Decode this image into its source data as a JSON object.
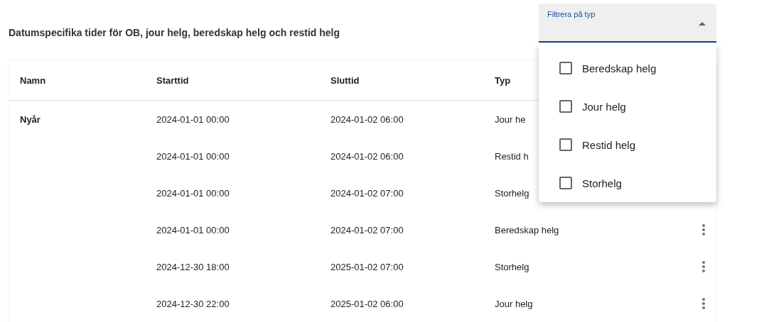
{
  "title": "Datumspecifika tider för OB, jour helg, beredskap helg och restid helg",
  "filter": {
    "label": "Filtrera på typ",
    "expanded": true,
    "options": [
      {
        "label": "Beredskap helg",
        "checked": false
      },
      {
        "label": "Jour helg",
        "checked": false
      },
      {
        "label": "Restid helg",
        "checked": false
      },
      {
        "label": "Storhelg",
        "checked": false
      }
    ]
  },
  "table": {
    "columns": [
      "Namn",
      "Starttid",
      "Sluttid",
      "Typ"
    ],
    "rows": [
      {
        "name": "Nyår",
        "start": "2024-01-01 00:00",
        "end": "2024-01-02 06:00",
        "type": "Jour he"
      },
      {
        "name": "",
        "start": "2024-01-01 00:00",
        "end": "2024-01-02 06:00",
        "type": "Restid h"
      },
      {
        "name": "",
        "start": "2024-01-01 00:00",
        "end": "2024-01-02 07:00",
        "type": "Storhelg"
      },
      {
        "name": "",
        "start": "2024-01-01 00:00",
        "end": "2024-01-02 07:00",
        "type": "Beredskap helg"
      },
      {
        "name": "",
        "start": "2024-12-30 18:00",
        "end": "2025-01-02 07:00",
        "type": "Storhelg"
      },
      {
        "name": "",
        "start": "2024-12-30 22:00",
        "end": "2025-01-02 06:00",
        "type": "Jour helg"
      }
    ]
  }
}
